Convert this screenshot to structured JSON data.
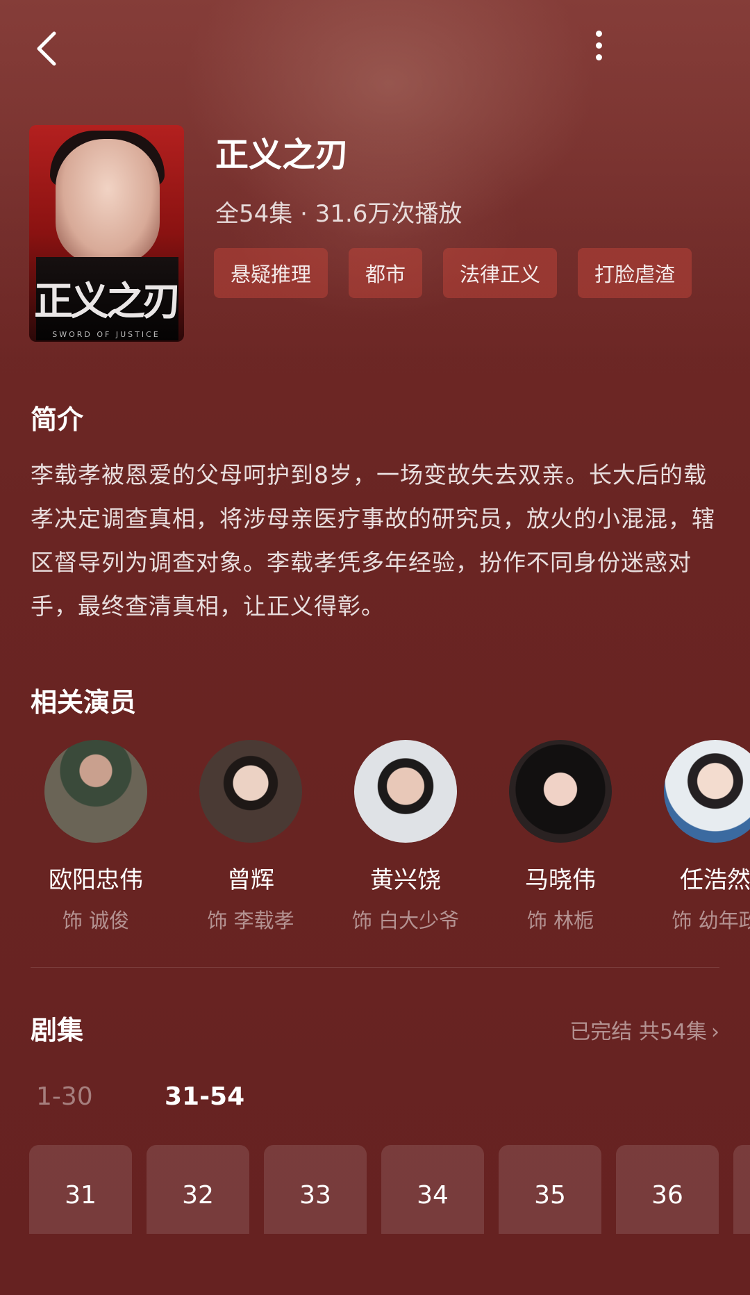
{
  "drama": {
    "title": "正义之刃",
    "meta": "全54集 · 31.6万次播放",
    "tags": [
      "悬疑推理",
      "都市",
      "法律正义",
      "打脸虐渣"
    ],
    "poster": {
      "title_text": "正义之刃",
      "subtitle_text": "SWORD OF JUSTICE"
    }
  },
  "intro": {
    "heading": "简介",
    "text": "李载孝被恩爱的父母呵护到8岁，一场变故失去双亲。长大后的载孝决定调查真相，将涉母亲医疗事故的研究员，放火的小混混，辖区督导列为调查对象。李载孝凭多年经验，扮作不同身份迷惑对手，最终查清真相，让正义得彰。"
  },
  "actors": {
    "heading": "相关演员",
    "items": [
      {
        "name": "欧阳忠伟",
        "role": "饰 诚俊"
      },
      {
        "name": "曾辉",
        "role": "饰 李载孝"
      },
      {
        "name": "黄兴饶",
        "role": "饰 白大少爷"
      },
      {
        "name": "马晓伟",
        "role": "饰 林栀"
      },
      {
        "name": "任浩然",
        "role": "饰 幼年政"
      }
    ]
  },
  "episodes": {
    "heading": "剧集",
    "status": "已完结 共54集",
    "ranges": [
      "1-30",
      "31-54"
    ],
    "active_range": "31-54",
    "items": [
      "31",
      "32",
      "33",
      "34",
      "35",
      "36"
    ]
  },
  "colors": {
    "background": "#6a2523",
    "tag_bg": "#8d3a33",
    "accent": "#ffffff"
  }
}
